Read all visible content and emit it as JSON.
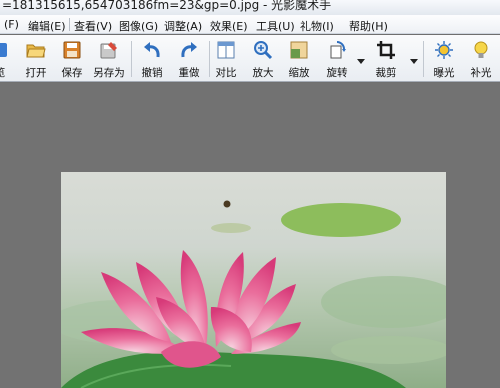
{
  "window": {
    "title": "=181315615,654703186fm=23&gp=0.jpg - 光影魔术手"
  },
  "menu": [
    {
      "label": "(F)"
    },
    {
      "label": "编辑(E)"
    },
    {
      "label": "查看(V)"
    },
    {
      "label": "图像(G)"
    },
    {
      "label": "调整(A)"
    },
    {
      "label": "效果(E)"
    },
    {
      "label": "工具(U)"
    },
    {
      "label": "礼物(I)"
    },
    {
      "label": "帮助(H)"
    }
  ],
  "toolbar": {
    "browse": "览",
    "open": "打开",
    "save": "保存",
    "save_as": "另存为",
    "undo": "撤销",
    "redo": "重做",
    "compare": "对比",
    "zoom_in": "放大",
    "shrink": "缩放",
    "rotate": "旋转",
    "crop": "裁剪",
    "exposure": "曝光",
    "fill_light": "补光"
  },
  "icons": {
    "open": "folder-open-icon",
    "save": "floppy-disk-icon",
    "save_as": "save-as-icon",
    "undo": "undo-arrow-icon",
    "redo": "redo-arrow-icon",
    "compare": "compare-icon",
    "zoom_in": "magnifier-plus-icon",
    "shrink": "resize-icon",
    "rotate": "rotate-icon",
    "crop": "crop-icon",
    "exposure": "sun-exposure-icon",
    "fill_light": "light-bulb-icon"
  },
  "colors": {
    "workspace": "#727272",
    "toolbar_icon": "#2f6fbf",
    "lotus_petal": "#e44a86"
  }
}
